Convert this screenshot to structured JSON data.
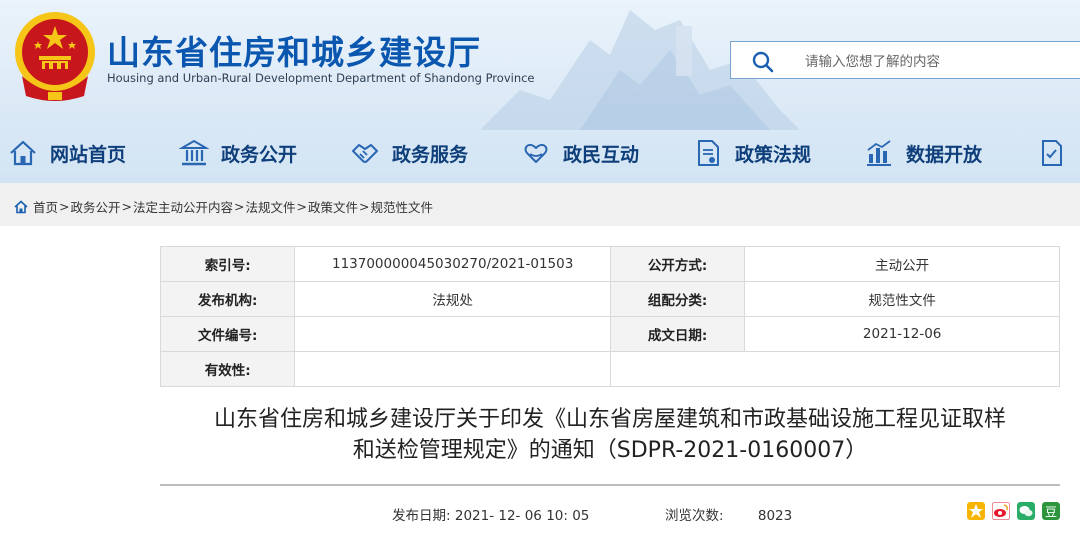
{
  "header": {
    "title": "山东省住房和城乡建设厅",
    "subtitle": "Housing and Urban-Rural Development Department of Shandong Province",
    "search_placeholder": "请输入您想了解的内容"
  },
  "nav": [
    {
      "label": "网站首页",
      "icon": "home-icon"
    },
    {
      "label": "政务公开",
      "icon": "government-building-icon"
    },
    {
      "label": "政务服务",
      "icon": "handshake-icon"
    },
    {
      "label": "政民互动",
      "icon": "heart-hands-icon"
    },
    {
      "label": "政策法规",
      "icon": "document-stamp-icon"
    },
    {
      "label": "数据开放",
      "icon": "bar-chart-icon"
    }
  ],
  "breadcrumb": [
    "首页",
    "政务公开",
    "法定主动公开内容",
    "法规文件",
    "政策文件",
    "规范性文件"
  ],
  "meta": {
    "index_no_label": "索引号:",
    "index_no": "113700000045030270/2021-01503",
    "disclosure_label": "公开方式:",
    "disclosure": "主动公开",
    "issuer_label": "发布机构:",
    "issuer": "法规处",
    "category_label": "组配分类:",
    "category": "规范性文件",
    "doc_no_label": "文件编号:",
    "doc_no": "",
    "created_label": "成文日期:",
    "created": "2021-12-06",
    "validity_label": "有效性:",
    "validity": ""
  },
  "doc": {
    "title_line1": "山东省住房和城乡建设厅关于印发《山东省房屋建筑和市政基础设施工程见证取样",
    "title_line2": "和送检管理规定》的通知（SDPR-2021-0160007）",
    "publish_label": "发布日期:",
    "publish_date": "2021- 12- 06 10: 05",
    "views_label": "浏览次数:",
    "views": "8023"
  },
  "share": [
    "qzone-icon",
    "weibo-icon",
    "wechat-icon",
    "douban-icon"
  ],
  "colors": {
    "brand_blue": "#0b57b0",
    "nav_text": "#0f3f7a",
    "breadcrumb_bg": "#f0f0f0",
    "emblem_red": "#c8161d",
    "emblem_gold": "#f5c518"
  }
}
